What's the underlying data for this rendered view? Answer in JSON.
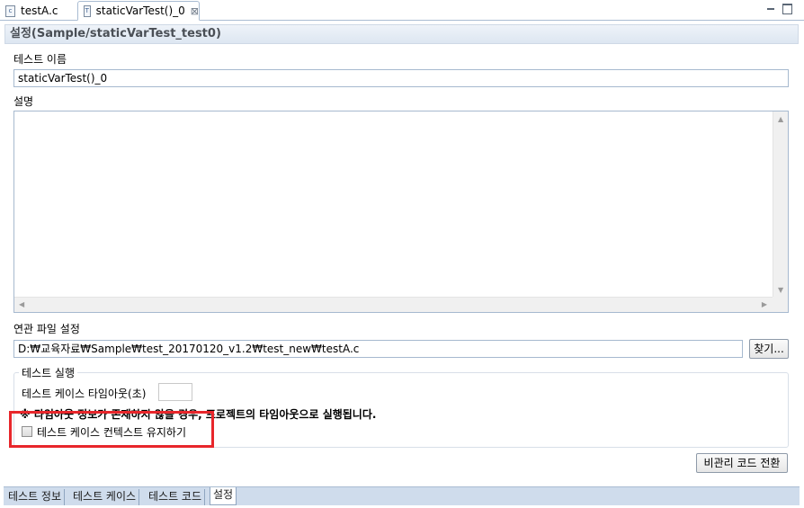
{
  "editor_tabs": [
    {
      "label": "testA.c",
      "icon": "c-file-icon",
      "active": false
    },
    {
      "label": "staticVarTest()_0",
      "icon": "test-file-icon",
      "active": true,
      "close": "⊠"
    }
  ],
  "header": {
    "title": "설정(Sample/staticVarTest_test0)"
  },
  "test_name": {
    "label": "테스트 이름",
    "value": "staticVarTest()_0"
  },
  "description": {
    "label": "설명",
    "value": ""
  },
  "related_file": {
    "label": "연관 파일 설정",
    "path": "D:₩교육자료₩Sample₩test_20170120_v1.2₩test_new₩testA.c",
    "browse_label": "찾기..."
  },
  "execution": {
    "group_label": "테스트 실행",
    "timeout_label": "테스트 케이스 타임아웃(초)",
    "timeout_value": "",
    "notice": "※ 타임아웃 정보가 존재하지 않을 경우, 프로젝트의 타임아웃으로 실행됩니다.",
    "keep_context_label": "테스트 케이스 컨텍스트 유지하기",
    "keep_context_checked": false
  },
  "convert_button": "비관리 코드 전환",
  "bottom_tabs": [
    {
      "label": "테스트 정보",
      "active": false
    },
    {
      "label": "테스트 케이스",
      "active": false
    },
    {
      "label": "테스트 코드",
      "active": false
    },
    {
      "label": "설정",
      "active": true
    }
  ],
  "colors": {
    "highlight": "#e8262b",
    "header_bg": "#dde6f1",
    "tab_strip": "#cfdcec"
  }
}
